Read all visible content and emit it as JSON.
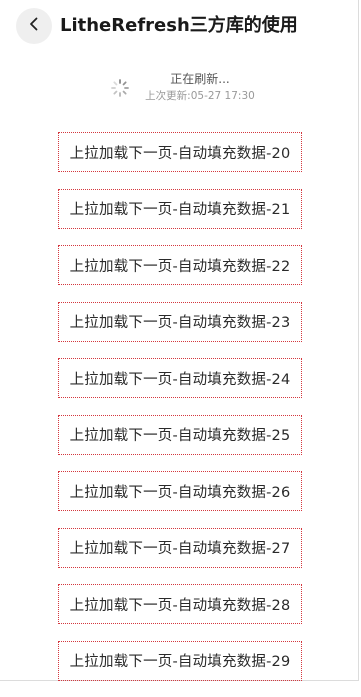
{
  "header": {
    "title": "LitheRefresh三方库的使用",
    "back_icon": "chevron-left-icon"
  },
  "refresh": {
    "status": "正在刷新...",
    "last_updated": "上次更新:05-27 17:30",
    "spinner_icon": "loading-spinner-icon"
  },
  "list": {
    "items": [
      "上拉加载下一页-自动填充数据-20",
      "上拉加载下一页-自动填充数据-21",
      "上拉加载下一页-自动填充数据-22",
      "上拉加载下一页-自动填充数据-23",
      "上拉加载下一页-自动填充数据-24",
      "上拉加载下一页-自动填充数据-25",
      "上拉加载下一页-自动填充数据-26",
      "上拉加载下一页-自动填充数据-27",
      "上拉加载下一页-自动填充数据-28",
      "上拉加载下一页-自动填充数据-29"
    ]
  },
  "colors": {
    "item_border": "#d4373e",
    "back_button_bg": "#efefef"
  }
}
